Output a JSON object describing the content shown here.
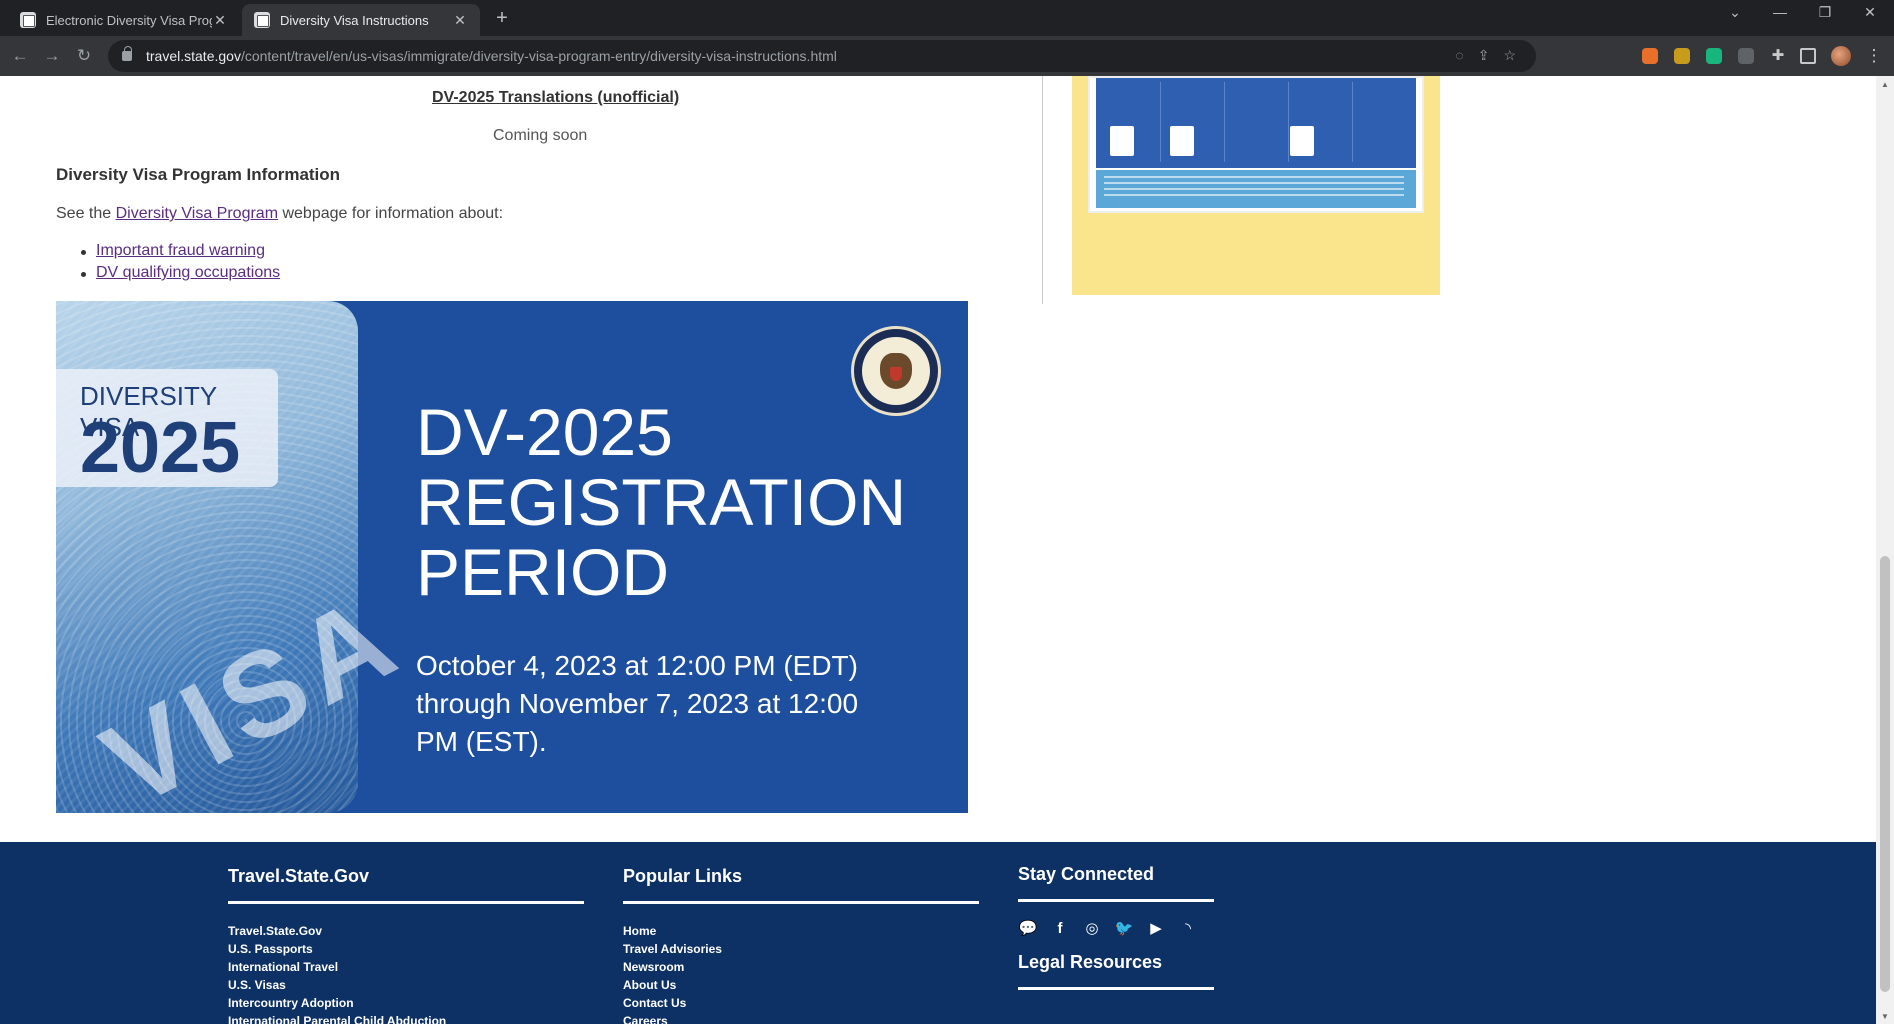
{
  "browser": {
    "tabs": [
      {
        "label": "Electronic Diversity Visa Program",
        "active": false
      },
      {
        "label": "Diversity Visa Instructions",
        "active": true
      }
    ],
    "url_host": "travel.state.gov",
    "url_path": "/content/travel/en/us-visas/immigrate/diversity-visa-program-entry/diversity-visa-instructions.html"
  },
  "content": {
    "translations_link": "DV-2025 Translations (unofficial)",
    "coming_soon": "Coming soon",
    "section_heading": "Diversity Visa Program Information",
    "see_the_prefix": "See the ",
    "see_the_link": "Diversity Visa Program",
    "see_the_suffix": " webpage for information about:",
    "bullets": [
      "Important fraud warning",
      "DV qualifying occupations"
    ]
  },
  "banner": {
    "badge_top": "DIVERSITY VISA",
    "badge_year": "2025",
    "visa_word": "VISA",
    "title_lines": [
      "DV-2025",
      "REGISTRATION",
      "PERIOD"
    ],
    "date_text": "October 4, 2023 at 12:00 PM (EDT) through November 7, 2023 at 12:00 PM (EST)."
  },
  "footer": {
    "col1": {
      "heading": "Travel.State.Gov",
      "links": [
        "Travel.State.Gov",
        "U.S. Passports",
        "International Travel",
        "U.S. Visas",
        "Intercountry Adoption",
        "International Parental Child Abduction"
      ]
    },
    "col2": {
      "heading": "Popular Links",
      "links": [
        "Home",
        "Travel Advisories",
        "Newsroom",
        "About Us",
        "Contact Us",
        "Careers"
      ]
    },
    "col3": {
      "heading": "Stay Connected",
      "social_icons": [
        "chat-icon",
        "facebook-icon",
        "instagram-icon",
        "twitter-icon",
        "youtube-icon",
        "rss-icon"
      ],
      "heading2": "Legal Resources"
    }
  },
  "colors": {
    "footer_bg": "#0d3164",
    "banner_bg": "#1d4f9e",
    "sidebar_yellow": "#fae58c",
    "link_purple": "#5a2d82"
  }
}
